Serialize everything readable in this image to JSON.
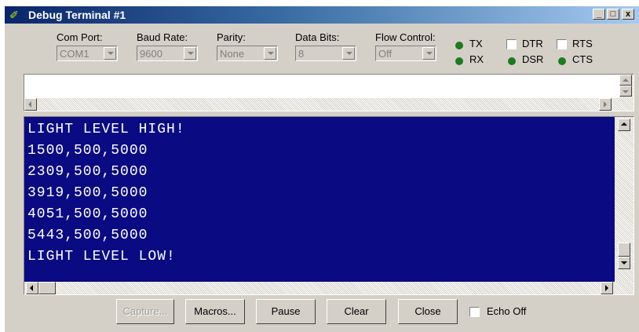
{
  "window": {
    "title": "Debug Terminal #1",
    "controls": {
      "minimize": "_",
      "maximize": "□",
      "close": "x"
    }
  },
  "settings": {
    "com_port": {
      "label": "Com Port:",
      "value": "COM1"
    },
    "baud_rate": {
      "label": "Baud Rate:",
      "value": "9600"
    },
    "parity": {
      "label": "Parity:",
      "value": "None"
    },
    "data_bits": {
      "label": "Data Bits:",
      "value": "8"
    },
    "flow_control": {
      "label": "Flow Control:",
      "value": "Off"
    }
  },
  "indicators": {
    "tx": "TX",
    "rx": "RX",
    "dsr": "DSR",
    "cts": "CTS",
    "led_color": "#1f7a1f"
  },
  "signals": {
    "dtr": "DTR",
    "rts": "RTS"
  },
  "terminal": {
    "background": "#0a0a82",
    "lines": [
      "LIGHT LEVEL HIGH!",
      "1500,500,5000",
      "2309,500,5000",
      "3919,500,5000",
      "4051,500,5000",
      "5443,500,5000",
      "LIGHT LEVEL LOW!"
    ]
  },
  "buttons": {
    "capture": "Capture...",
    "macros": "Macros...",
    "pause": "Pause",
    "clear": "Clear",
    "close": "Close"
  },
  "echo_off": {
    "label": "Echo Off",
    "checked": false
  },
  "icons": {
    "app": "app-icon",
    "arrow_left": "arrow-left-icon",
    "arrow_right": "arrow-right-icon",
    "arrow_up": "arrow-up-icon",
    "arrow_down": "arrow-down-icon"
  }
}
